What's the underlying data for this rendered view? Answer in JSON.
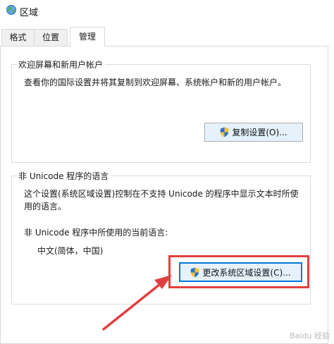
{
  "window": {
    "title": "区域"
  },
  "tabs": [
    {
      "label": "格式",
      "active": false
    },
    {
      "label": "位置",
      "active": false
    },
    {
      "label": "管理",
      "active": true
    }
  ],
  "welcome_group": {
    "title": "欢迎屏幕和新用户帐户",
    "description": "查看你的国际设置并将其复制到欢迎屏幕、系统帐户和新的用户帐户。",
    "copy_button": "复制设置(O)..."
  },
  "non_unicode_group": {
    "title": "非 Unicode 程序的语言",
    "description_line1": "这个设置(系统区域设置)控制在不支持 Unicode 的程序中显示文本时所使",
    "description_line2": "用的语言。",
    "current_label": "非 Unicode 程序中所使用的当前语言:",
    "current_value": "中文(简体，中国)",
    "change_button": "更改系统区域设置(C)..."
  },
  "annotation": {
    "highlight_color": "#e0403f",
    "arrow_color": "#e0403f"
  },
  "watermark": {
    "text": "Baidu 经验"
  },
  "colors": {
    "focus_border": "#0078d7",
    "button_bg": "#e5f1fb",
    "uac_blue": "#2a6fd6",
    "uac_yellow": "#f4c430"
  }
}
